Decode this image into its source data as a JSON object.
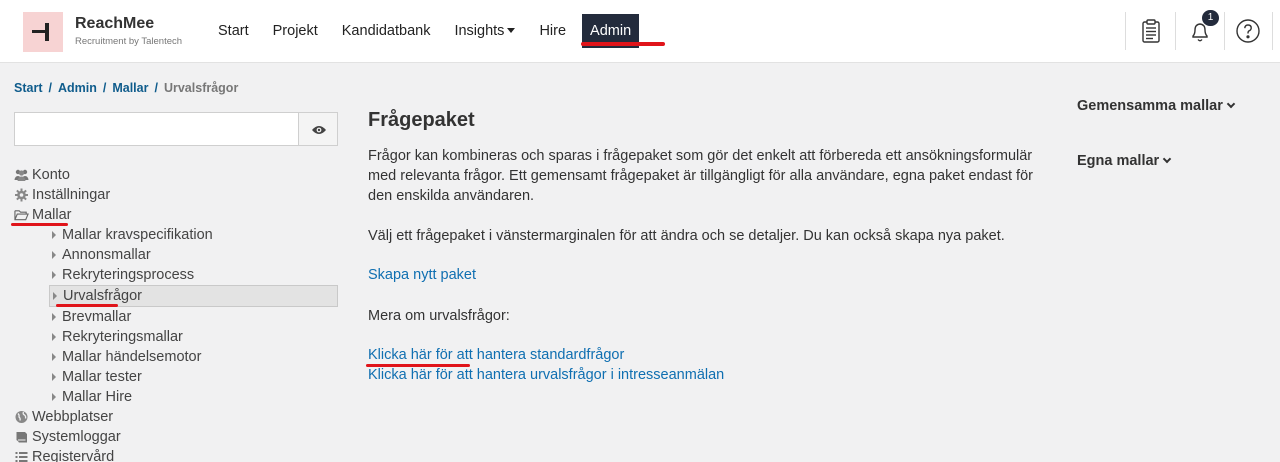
{
  "brand": {
    "name": "ReachMee",
    "subtitle": "Recruitment by Talentech"
  },
  "nav": [
    {
      "label": "Start"
    },
    {
      "label": "Projekt"
    },
    {
      "label": "Kandidatbank"
    },
    {
      "label": "Insights"
    },
    {
      "label": "Hire"
    },
    {
      "label": "Admin"
    }
  ],
  "header": {
    "notification_count": "1",
    "icons": [
      "clipboard-icon",
      "bell-icon",
      "help-icon"
    ]
  },
  "breadcrumb": {
    "items": [
      "Start",
      "Admin",
      "Mallar"
    ],
    "current": "Urvalsfrågor"
  },
  "search": {
    "value": "",
    "placeholder": ""
  },
  "sidebar": {
    "top": [
      {
        "label": "Konto",
        "icon": "users-icon"
      },
      {
        "label": "Inställningar",
        "icon": "gear-icon"
      },
      {
        "label": "Mallar",
        "icon": "folder-open-icon"
      }
    ],
    "mallar_children": [
      "Mallar kravspecifikation",
      "Annonsmallar",
      "Rekryteringsprocess",
      "Urvalsfrågor",
      "Brevmallar",
      "Rekryteringsmallar",
      "Mallar händelsemotor",
      "Mallar tester",
      "Mallar Hire"
    ],
    "bottom": [
      {
        "label": "Webbplatser",
        "icon": "globe-icon"
      },
      {
        "label": "Systemloggar",
        "icon": "book-icon"
      },
      {
        "label": "Registervård",
        "icon": "list-icon"
      }
    ]
  },
  "main": {
    "title": "Frågepaket",
    "intro": "Frågor kan kombineras och sparas i frågepaket som gör det enkelt att förbereda ett ansökningsformulär med relevanta frågor. Ett gemensamt frågepaket är tillgängligt för alla användare, egna paket endast för den enskilda användaren.",
    "instruction": "Välj ett frågepaket i vänstermarginalen för att ändra och se detaljer. Du kan också skapa nya paket.",
    "create_link": "Skapa nytt paket",
    "more_label": "Mera om urvalsfrågor:",
    "link_standard": "Klicka här för att hantera standardfrågor",
    "link_interest": "Klicka här för att hantera urvalsfrågor i intresseanmälan"
  },
  "right": {
    "shared_templates": "Gemensamma mallar",
    "own_templates": "Egna mallar"
  },
  "colors": {
    "accent_red": "#e0141a",
    "nav_active_bg": "#232b3c",
    "link": "#0f6fb1",
    "logo_bg": "#f7d3d3"
  }
}
